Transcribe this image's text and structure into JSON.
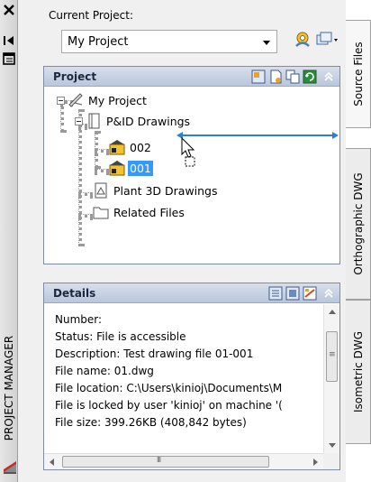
{
  "palette": {
    "title": "PROJECT MANAGER"
  },
  "current_project": {
    "label": "Current Project:",
    "value": "My Project"
  },
  "project_section": {
    "title": "Project",
    "tree": [
      {
        "label": "My Project",
        "level": 0,
        "icon": "project-icon"
      },
      {
        "label": "P&ID Drawings",
        "level": 1,
        "icon": "pid-folder-icon"
      },
      {
        "label": "002",
        "level": 2,
        "icon": "drawing-file-icon"
      },
      {
        "label": "001",
        "level": 2,
        "icon": "drawing-file-icon",
        "selected": true
      },
      {
        "label": "Plant 3D Drawings",
        "level": 1,
        "icon": "plant3d-folder-icon"
      },
      {
        "label": "Related Files",
        "level": 1,
        "icon": "folder-icon"
      }
    ]
  },
  "details_section": {
    "title": "Details",
    "lines": [
      "Number:",
      "Status: File is accessible",
      "Description: Test drawing file 01-001",
      "File name: 01.dwg",
      "File location: C:\\Users\\kinioj\\Documents\\M",
      "File is locked by user 'kinioj' on machine '(",
      "File size: 399.26KB (408,842 bytes)"
    ]
  },
  "right_tabs": [
    "Source Files",
    "Orthographic DWG",
    "Isometric DWG"
  ],
  "colors": {
    "selection": "#3399ff",
    "drag_indicator": "#2d7fd6",
    "section_header": "#c7d2e5"
  }
}
